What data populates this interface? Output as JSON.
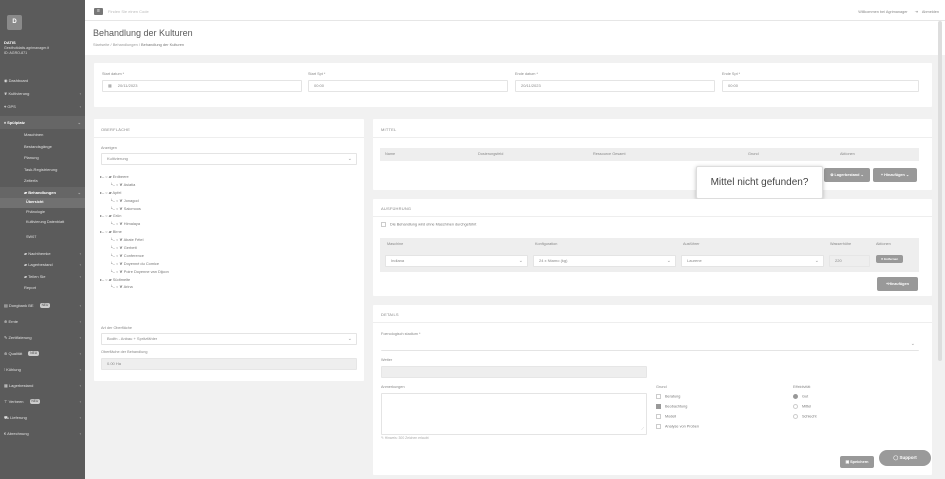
{
  "sidebar": {
    "logo": "D",
    "org_name": "DATIS",
    "org_sub": "Gestfruitdatis.agrimanager.it",
    "org_id": "ID: AGRO-871",
    "items": [
      {
        "label": "Dashboard",
        "icon": "dashboard-icon"
      },
      {
        "label": "Kultivierung",
        "icon": "leaf-icon"
      },
      {
        "label": "GPS",
        "icon": "pin-icon"
      },
      {
        "label": "Spülplatz",
        "icon": "tool-icon"
      }
    ],
    "sub_items": [
      "Maschinen",
      "Bestandsgänge",
      "Planung",
      "Task-Registrierung",
      "Zeiterfa"
    ],
    "behandlungen": "Behandlungen",
    "sub2_items": [
      "Übersicht",
      "Phänologie",
      "Kultivierung Datenblatt",
      "SW07"
    ],
    "lower_items": [
      "Nachthemke",
      "Lagerbestand",
      "Teilen Sie"
    ],
    "report": "Report",
    "bottom_items": [
      {
        "label": "Dongbank BE",
        "badge": "NEU"
      },
      {
        "label": "Ernte"
      },
      {
        "label": "Zertifizierung"
      },
      {
        "label": "Qualität",
        "badge": "NEU"
      },
      {
        "label": "Kühlung"
      },
      {
        "label": "Lagerbestand"
      },
      {
        "label": "Verbeen",
        "badge": "NEU"
      },
      {
        "label": "Lieferung"
      },
      {
        "label": "Abrechnung"
      }
    ]
  },
  "topbar": {
    "search_placeholder": "Finden Sie einen Code",
    "welcome": "Willkommen bei Agrimanager",
    "logout": "Abmelden"
  },
  "page": {
    "title": "Behandlung der Kulturen",
    "breadcrumb": [
      "Startseite",
      "Behandlungen",
      "Behandlung der Kulturen"
    ]
  },
  "dates": {
    "start_date_label": "Start datum *",
    "start_date": "20/11/2023",
    "start_time_label": "Start Spt *",
    "start_time": "00:00",
    "end_date_label": "Ende datum *",
    "end_date": "20/11/2023",
    "end_time_label": "Ende Spt *",
    "end_time": "00:00"
  },
  "surface": {
    "title": "OBERFLÄCHE",
    "show_label": "Anzeigen",
    "show_value": "Kultivierung",
    "tree": [
      {
        "level": 0,
        "label": "Erdbeere",
        "type": "folder"
      },
      {
        "level": 1,
        "label": "Asiatia",
        "type": "leaf"
      },
      {
        "level": 0,
        "label": "Apfel",
        "type": "folder"
      },
      {
        "level": 1,
        "label": "Jonagod",
        "type": "leaf"
      },
      {
        "level": 1,
        "label": "Saicmoos",
        "type": "leaf"
      },
      {
        "level": 0,
        "label": "Grün",
        "type": "folder"
      },
      {
        "level": 1,
        "label": "Himalaya",
        "type": "leaf"
      },
      {
        "level": 0,
        "label": "Birne",
        "type": "folder"
      },
      {
        "level": 1,
        "label": "Abate Fétel",
        "type": "leaf"
      },
      {
        "level": 1,
        "label": "Gerbett",
        "type": "leaf"
      },
      {
        "level": 1,
        "label": "Conference",
        "type": "leaf"
      },
      {
        "level": 1,
        "label": "Doyenné du Comice",
        "type": "leaf"
      },
      {
        "level": 1,
        "label": "Poire Doyenne van Dijcon",
        "type": "leaf"
      },
      {
        "level": 0,
        "label": "Südtmelte",
        "type": "folder"
      },
      {
        "level": 1,
        "label": "Arina",
        "type": "leaf"
      }
    ],
    "type_label": "Art der Oberfläche",
    "type_value": "Bodfn - Anbau + Spritzfähler",
    "area_label": "Oberfläche der Behandlung",
    "area_value": "0.00 Ha"
  },
  "means": {
    "title": "MITTEL",
    "columns": [
      "Name",
      "Dosierungsfeld",
      "Ressource Gesamt",
      "Grund",
      "Aktionen"
    ],
    "tooltip": "Mittel nicht gefunden?",
    "stock_button": "Lagerbestand",
    "add_button": "Hinzufügen"
  },
  "execution": {
    "title": "AUSFÜHRUNG",
    "no_machine_label": "Die Behandlung wird ohne Maschinen durchgeführt",
    "columns": [
      "Maschine",
      "Konfiguration",
      "Ausführer",
      "Wasserhöhe",
      "Aktionen"
    ],
    "machine": "Indiana",
    "config": "24 x Ntamo (kg)",
    "operator": "Laurene",
    "water": "220",
    "delete_button": "Entfernen",
    "add_button": "Hinzufügen"
  },
  "details": {
    "title": "DETAILS",
    "phase_label": "Foenologisch stadium *",
    "weather_label": "Wetter",
    "notes_label": "Anmerkungen",
    "notes_hint": "Hinweis: 300 Zeichen erlaubt",
    "reason_label": "Grund",
    "reasons": [
      {
        "label": "Beratung",
        "checked": false
      },
      {
        "label": "Beobachtung",
        "checked": true
      },
      {
        "label": "Modell",
        "checked": false
      },
      {
        "label": "Analyse von Proben",
        "checked": false
      }
    ],
    "efficacy_label": "Effektivität",
    "efficacy": [
      {
        "label": "Gut",
        "checked": true
      },
      {
        "label": "Mittel",
        "checked": false
      },
      {
        "label": "Schlecht",
        "checked": false
      }
    ],
    "save_button": "Speichern"
  },
  "support": "Support"
}
